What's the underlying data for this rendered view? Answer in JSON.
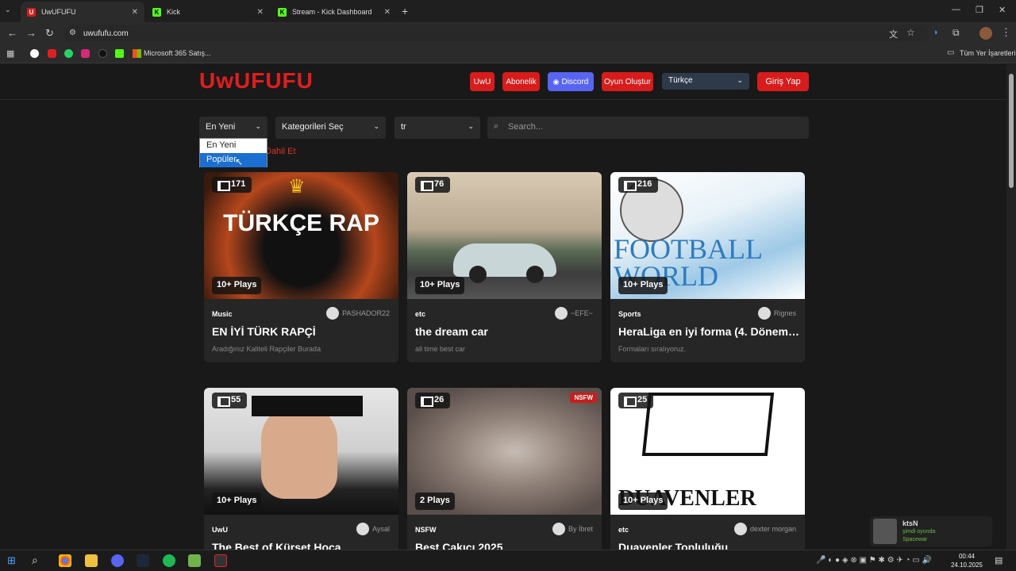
{
  "browser": {
    "tabs": [
      {
        "label": "UwUFUFU",
        "icon": "U"
      },
      {
        "label": "Kick",
        "icon": "K"
      },
      {
        "label": "Stream - Kick Dashboard",
        "icon": "K"
      }
    ],
    "url": "uwufufu.com",
    "bookmark_label": "Microsoft 365 Satış...",
    "bookmarks_folder": "Tüm Yer İşaretleri"
  },
  "site": {
    "logo": "UwUFUFU",
    "nav": {
      "uwu": "UwU",
      "subscription": "Abonelik",
      "discord": "Discord",
      "create_game": "Oyun Oluştur",
      "login": "Giriş Yap"
    },
    "language_select": "Türkçe"
  },
  "filters": {
    "sort_value": "En Yeni",
    "category_value": "Kategorileri Seç",
    "lang_value": "tr",
    "search_placeholder": "Search...",
    "sort_options": [
      "En Yeni",
      "Popüler"
    ],
    "include_label": "Dahil Et"
  },
  "cards": [
    {
      "count": "171",
      "plays": "10+ Plays",
      "category": "Music",
      "user": "PASHADOR22",
      "title": "EN İYİ TÜRK RAPÇİ",
      "desc": "Aradığınız Kaliteli Rapçiler Burada",
      "thumb_text": "TÜRKÇE RAP"
    },
    {
      "count": "76",
      "plays": "10+ Plays",
      "category": "etc",
      "user": "~EFE~",
      "title": "the dream car",
      "desc": "all time best car"
    },
    {
      "count": "216",
      "plays": "10+ Plays",
      "category": "Sports",
      "user": "Rignes",
      "title": "HeraLiga en iyi forma (4. Dönem ...",
      "desc": "Formaları sıralıyoruz.",
      "thumb_text": "FOOTBALL WORLD"
    },
    {
      "count": "55",
      "plays": "10+ Plays",
      "category": "UwU",
      "user": "Aysal",
      "title": "The Best of Kürşet Hoca",
      "desc": ""
    },
    {
      "count": "26",
      "plays": "2 Plays",
      "category": "NSFW",
      "user": "By İbret",
      "title": "Best Çakıcı 2025",
      "desc": "",
      "badge": "NSFW"
    },
    {
      "count": "25",
      "plays": "10+ Plays",
      "category": "etc",
      "user": "dexter morgan",
      "title": "Duavenler Topluluğu",
      "desc": "",
      "thumb_text": "DUAVENLER"
    }
  ],
  "now_playing": {
    "name": "ktsN",
    "status": "şimdi oyunda",
    "game": "Spacewar"
  },
  "taskbar": {
    "time": "00:44",
    "date": "24.10.2025"
  }
}
